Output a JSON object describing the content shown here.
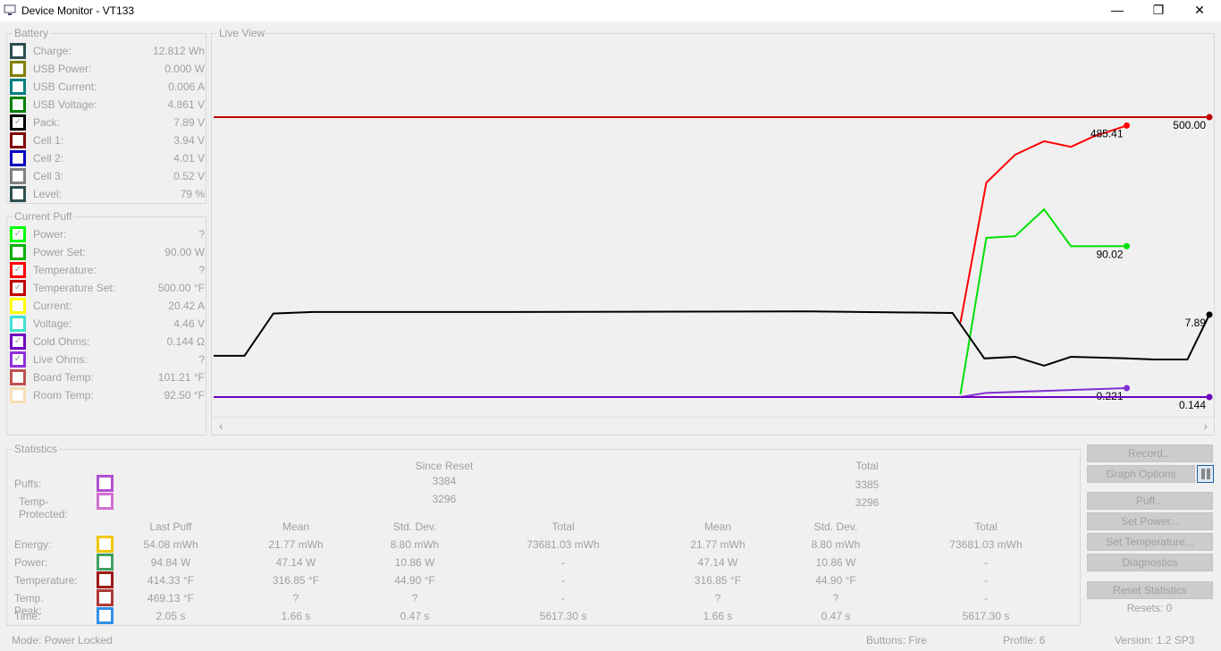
{
  "window": {
    "title": "Device Monitor - VT133",
    "minimize": "—",
    "maximize": "❐",
    "close": "✕"
  },
  "battery": {
    "caption": "Battery",
    "items": [
      {
        "label": "Charge:",
        "value": "12.812 Wh",
        "color": "#2f4f4f",
        "checked": false
      },
      {
        "label": "USB Power:",
        "value": "0.000 W",
        "color": "#808000",
        "checked": false
      },
      {
        "label": "USB Current:",
        "value": "0.006 A",
        "color": "#008080",
        "checked": false
      },
      {
        "label": "USB Voltage:",
        "value": "4.861 V",
        "color": "#008000",
        "checked": false
      },
      {
        "label": "Pack:",
        "value": "7.89 V",
        "color": "#000000",
        "checked": true
      },
      {
        "label": "Cell 1:",
        "value": "3.94 V",
        "color": "#800000",
        "checked": false
      },
      {
        "label": "Cell 2:",
        "value": "4.01 V",
        "color": "#0000c0",
        "checked": false
      },
      {
        "label": "Cell 3:",
        "value": "0.52 V",
        "color": "#808080",
        "checked": false
      },
      {
        "label": "Level:",
        "value": "79 %",
        "color": "#2f4f4f",
        "checked": false
      }
    ]
  },
  "puff": {
    "caption": "Current Puff",
    "items": [
      {
        "label": "Power:",
        "value": "?",
        "color": "#00ff00",
        "checked": true
      },
      {
        "label": "Power Set:",
        "value": "90.00 W",
        "color": "#00b000",
        "checked": false
      },
      {
        "label": "Temperature:",
        "value": "?",
        "color": "#ff0000",
        "checked": true
      },
      {
        "label": "Temperature Set:",
        "value": "500.00 °F",
        "color": "#c00000",
        "checked": true
      },
      {
        "label": "Current:",
        "value": "20.42 A",
        "color": "#ffff00",
        "checked": false
      },
      {
        "label": "Voltage:",
        "value": "4.46 V",
        "color": "#40e0d0",
        "checked": false
      },
      {
        "label": "Cold Ohms:",
        "value": "0.144 Ω",
        "color": "#7000c0",
        "checked": true
      },
      {
        "label": "Live Ohms:",
        "value": "?",
        "color": "#9030e0",
        "checked": true
      },
      {
        "label": "Board Temp:",
        "value": "101.21 °F",
        "color": "#c05050",
        "checked": false
      },
      {
        "label": "Room Temp:",
        "value": "92.50 °F",
        "color": "#f5deb3",
        "checked": false
      }
    ]
  },
  "live_view": {
    "caption": "Live View",
    "scroll_left": "‹",
    "scroll_right": "›"
  },
  "chart_data": {
    "type": "line",
    "grid": false,
    "series": [
      {
        "key": "temp_set",
        "color": "#c00000",
        "ylim": [
          0,
          500
        ],
        "x": [
          0,
          100
        ],
        "y": [
          500,
          500
        ],
        "end_label": "500.00"
      },
      {
        "key": "temperature",
        "color": "#ff0000",
        "ylim": [
          0,
          500
        ],
        "x": [
          75,
          77.6,
          80.5,
          83.4,
          86.1,
          88.3,
          91.7
        ],
        "y": [
          133,
          383,
          433,
          457,
          447,
          465,
          485
        ],
        "end_label": "485.41"
      },
      {
        "key": "power",
        "color": "#00e000",
        "ylim": [
          0,
          167
        ],
        "x": [
          75,
          77.6,
          80.5,
          83.4,
          86.1,
          91.7
        ],
        "y": [
          1.6,
          95,
          96,
          112,
          90,
          90.02
        ],
        "end_label": "90.02"
      },
      {
        "key": "pack",
        "color": "#000000",
        "ylim": [
          0,
          26.8
        ],
        "x": [
          0,
          3.1,
          6,
          10,
          30,
          60,
          74.2,
          77.4,
          80.5,
          83.4,
          86.1,
          91.7,
          94.4,
          97.8,
          100
        ],
        "y": [
          3.95,
          3.95,
          8.0,
          8.15,
          8.15,
          8.2,
          8.05,
          3.7,
          3.85,
          3.0,
          3.85,
          3.7,
          3.6,
          3.6,
          7.89
        ],
        "end_label": "7.89"
      },
      {
        "key": "live_ohms",
        "color": "#8030d0",
        "ylim": [
          0.144,
          2.55
        ],
        "x": [
          75,
          77.6,
          91.7
        ],
        "y": [
          0.144,
          0.18,
          0.221
        ],
        "end_label": "0.221"
      },
      {
        "key": "cold_ohms",
        "color": "#7000c0",
        "ylim": [
          0.144,
          2.55
        ],
        "x": [
          0,
          100
        ],
        "y": [
          0.144,
          0.144
        ],
        "end_label": "0.144"
      }
    ]
  },
  "statistics": {
    "caption": "Statistics",
    "since_reset": "Since Reset",
    "total": "Total",
    "puffs": {
      "label": "Puffs:",
      "color": "#b050d0",
      "since": "3384",
      "total": "3385"
    },
    "temp_protected": {
      "label": "Temp-Protected:",
      "color": "#d070d0",
      "since": "3296",
      "total": "3296"
    },
    "headers": [
      "Last Puff",
      "Mean",
      "Std. Dev.",
      "Total",
      "Mean",
      "Std. Dev.",
      "Total"
    ],
    "rows": [
      {
        "label": "Energy:",
        "color": "#f0c800",
        "values": [
          "54.08 mWh",
          "21.77 mWh",
          "8.80 mWh",
          "73681.03 mWh",
          "21.77 mWh",
          "8.80 mWh",
          "73681.03 mWh"
        ]
      },
      {
        "label": "Power:",
        "color": "#40a060",
        "values": [
          "94.84 W",
          "47.14 W",
          "10.86 W",
          "-",
          "47.14 W",
          "10.86 W",
          "-"
        ]
      },
      {
        "label": "Temperature:",
        "color": "#a01818",
        "values": [
          "414.33 °F",
          "316.85 °F",
          "44.90 °F",
          "-",
          "316.85 °F",
          "44.90 °F",
          "-"
        ]
      },
      {
        "label": "Temp. Peak:",
        "color": "#b03838",
        "values": [
          "469.13 °F",
          "?",
          "?",
          "-",
          "?",
          "?",
          "-"
        ]
      },
      {
        "label": "Time:",
        "color": "#3090e8",
        "values": [
          "2.05 s",
          "1.66 s",
          "0.47 s",
          "5617.30 s",
          "1.66 s",
          "0.47 s",
          "5617.30 s"
        ]
      }
    ]
  },
  "buttons": {
    "record": "Record...",
    "graph_options": "Graph Options",
    "puff": "Puff...",
    "set_power": "Set Power...",
    "set_temperature": "Set Temperature...",
    "diagnostics": "Diagnostics",
    "reset_statistics": "Reset Statistics",
    "resets": "Resets: 0"
  },
  "status": {
    "mode": "Mode: Power Locked",
    "buttons": "Buttons: Fire",
    "profile": "Profile: 6",
    "version": "Version: 1.2 SP3"
  }
}
